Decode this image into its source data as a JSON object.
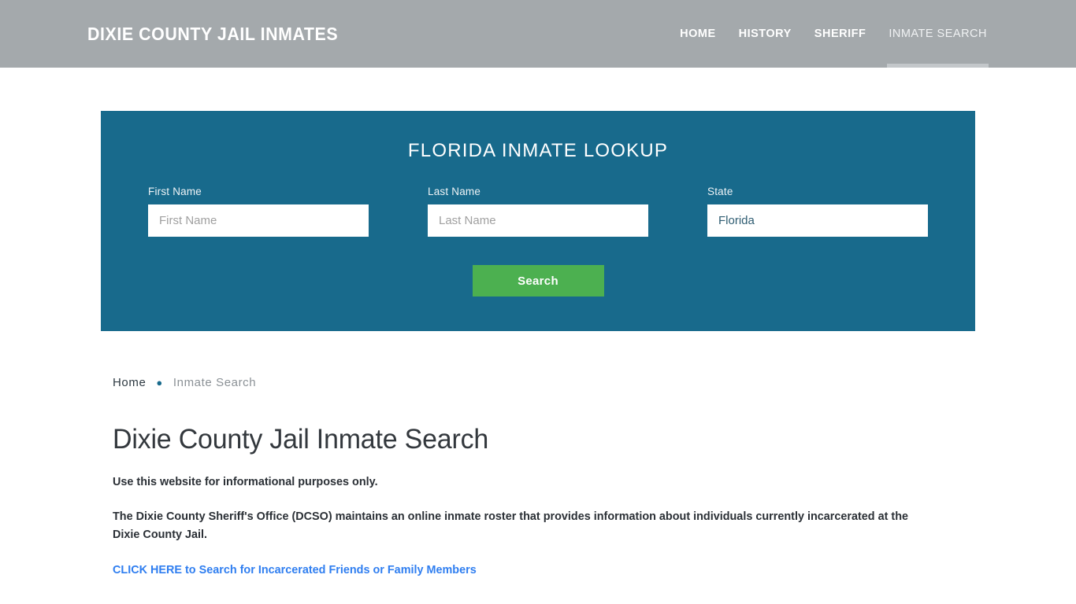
{
  "header": {
    "site_title": "DIXIE COUNTY JAIL INMATES",
    "nav": [
      {
        "label": "HOME",
        "active": false
      },
      {
        "label": "HISTORY",
        "active": false
      },
      {
        "label": "SHERIFF",
        "active": false
      },
      {
        "label": "INMATE SEARCH",
        "active": true
      }
    ]
  },
  "lookup": {
    "title": "FLORIDA INMATE LOOKUP",
    "first_name": {
      "label": "First Name",
      "placeholder": "First Name",
      "value": ""
    },
    "last_name": {
      "label": "Last Name",
      "placeholder": "Last Name",
      "value": ""
    },
    "state": {
      "label": "State",
      "placeholder": "State",
      "value": "Florida"
    },
    "search_button": "Search"
  },
  "breadcrumb": {
    "home": "Home",
    "separator": "●",
    "current": "Inmate Search"
  },
  "main": {
    "page_title": "Dixie County Jail Inmate Search",
    "paragraph_1": "Use this website for informational purposes only.",
    "paragraph_2": "The Dixie County Sheriff's Office (DCSO) maintains an online inmate roster that provides information about individuals currently incarcerated at the Dixie County Jail.",
    "cta_link": "CLICK HERE to Search for Incarcerated Friends or Family Members"
  },
  "colors": {
    "header_bg": "#a4a9ac",
    "panel_bg": "#186a8c",
    "button_green": "#4cb050",
    "link_blue": "#2f7ef0",
    "accent_teal": "#186a8c"
  }
}
